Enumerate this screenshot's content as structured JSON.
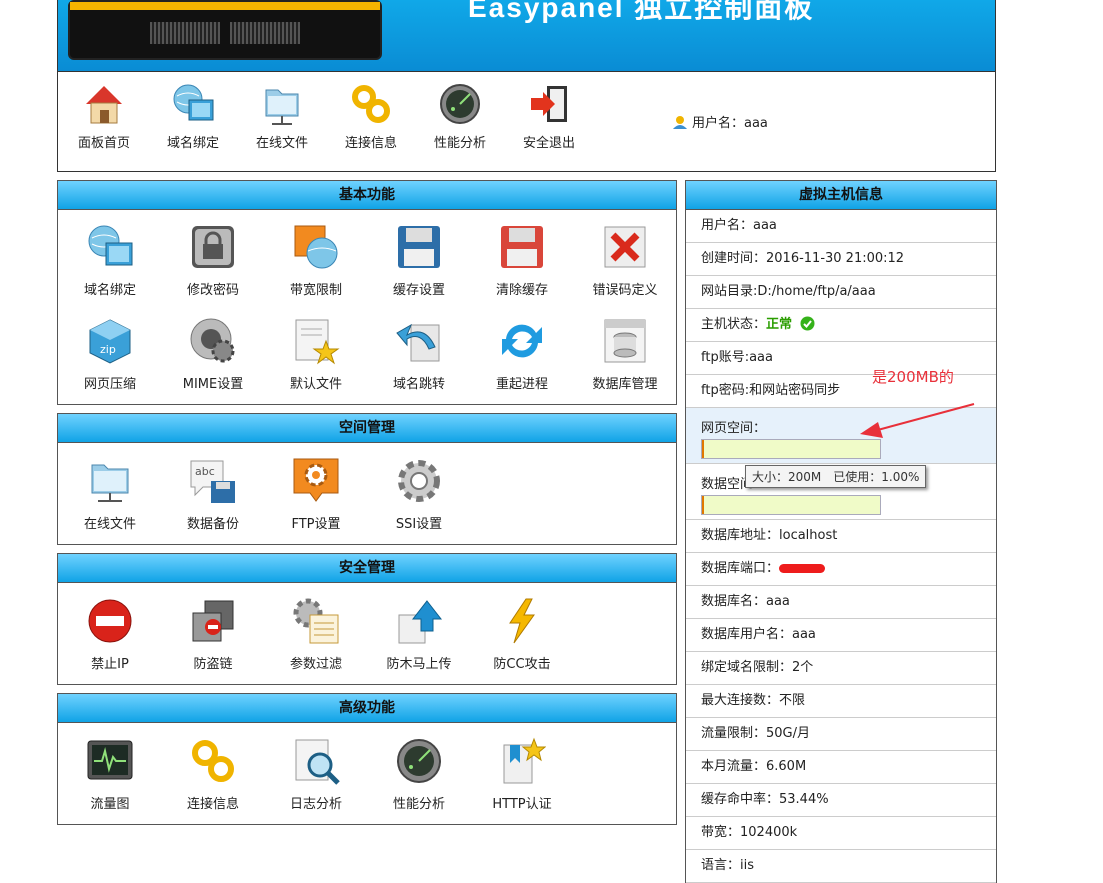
{
  "header": {
    "title": "Easypanel 独立控制面板"
  },
  "topnav": {
    "items": [
      {
        "label": "面板首页",
        "icon": "home-icon"
      },
      {
        "label": "域名绑定",
        "icon": "globe-monitor-icon"
      },
      {
        "label": "在线文件",
        "icon": "folder-network-icon"
      },
      {
        "label": "连接信息",
        "icon": "chain-link-icon"
      },
      {
        "label": "性能分析",
        "icon": "radar-icon"
      },
      {
        "label": "安全退出",
        "icon": "exit-door-icon"
      }
    ],
    "user": "用户名：aaa"
  },
  "panels": {
    "basic": {
      "title": "基本功能",
      "items": [
        {
          "label": "域名绑定",
          "icon": "globe-monitor-icon"
        },
        {
          "label": "修改密码",
          "icon": "lock-icon"
        },
        {
          "label": "带宽限制",
          "icon": "bandwidth-globe-icon"
        },
        {
          "label": "缓存设置",
          "icon": "floppy-icon"
        },
        {
          "label": "清除缓存",
          "icon": "floppy-clear-icon"
        },
        {
          "label": "错误码定义",
          "icon": "error-x-icon"
        },
        {
          "label": "网页压缩",
          "icon": "zip-cube-icon"
        },
        {
          "label": "MIME设置",
          "icon": "gear-disc-icon"
        },
        {
          "label": "默认文件",
          "icon": "document-star-icon"
        },
        {
          "label": "域名跳转",
          "icon": "redirect-arrow-icon"
        },
        {
          "label": "重起进程",
          "icon": "refresh-icon"
        },
        {
          "label": "数据库管理",
          "icon": "database-icon"
        }
      ]
    },
    "space": {
      "title": "空间管理",
      "items": [
        {
          "label": "在线文件",
          "icon": "folder-network-icon"
        },
        {
          "label": "数据备份",
          "icon": "backup-floppy-icon"
        },
        {
          "label": "FTP设置",
          "icon": "ftp-gear-icon"
        },
        {
          "label": "SSI设置",
          "icon": "gear-icon"
        }
      ]
    },
    "security": {
      "title": "安全管理",
      "items": [
        {
          "label": "禁止IP",
          "icon": "no-entry-icon"
        },
        {
          "label": "防盗链",
          "icon": "anti-leech-icon"
        },
        {
          "label": "参数过滤",
          "icon": "filter-gear-icon"
        },
        {
          "label": "防木马上传",
          "icon": "upload-shield-icon"
        },
        {
          "label": "防CC攻击",
          "icon": "lightning-icon"
        }
      ]
    },
    "advanced": {
      "title": "高级功能",
      "items": [
        {
          "label": "流量图",
          "icon": "traffic-monitor-icon"
        },
        {
          "label": "连接信息",
          "icon": "chain-link-icon"
        },
        {
          "label": "日志分析",
          "icon": "log-magnifier-icon"
        },
        {
          "label": "性能分析",
          "icon": "radar-icon"
        },
        {
          "label": "HTTP认证",
          "icon": "bookmark-star-icon"
        }
      ]
    }
  },
  "vhost": {
    "title": "虚拟主机信息",
    "username": "用户名：aaa",
    "created": "创建时间：2016-11-30 21:00:12",
    "docroot": "网站目录:D:/home/ftp/a/aaa",
    "status_label": "主机状态：",
    "status_value": "正常",
    "ftp_account": "ftp账号:aaa",
    "ftp_password": "ftp密码:和网站密码同步",
    "web_space_label": "网页空间：",
    "web_space_used_fraction": 0.01,
    "db_space_label": "数据空间：",
    "db_space_used_fraction": 0.01,
    "db_host": "数据库地址：localhost",
    "db_port_label": "数据库端口：",
    "db_name": "数据库名：aaa",
    "db_user": "数据库用户名：aaa",
    "domain_limit": "绑定域名限制：2个",
    "max_conn": "最大连接数：不限",
    "traffic_limit": "流量限制：50G/月",
    "month_traffic": "本月流量：6.60M",
    "cache_hit": "缓存命中率：53.44%",
    "bandwidth": "带宽：102400k",
    "language": "语言：iis"
  },
  "tooltip": "大小：200M　已使用：1.00%",
  "annotation": "是200MB的",
  "colors": {
    "header_blue": "#0a8cd4",
    "panel_title": "#10a3e6",
    "status_ok": "#2a9d00",
    "annotation_red": "#e8303a",
    "space_bar": "#f0fbc8",
    "space_fill": "#e07800"
  }
}
